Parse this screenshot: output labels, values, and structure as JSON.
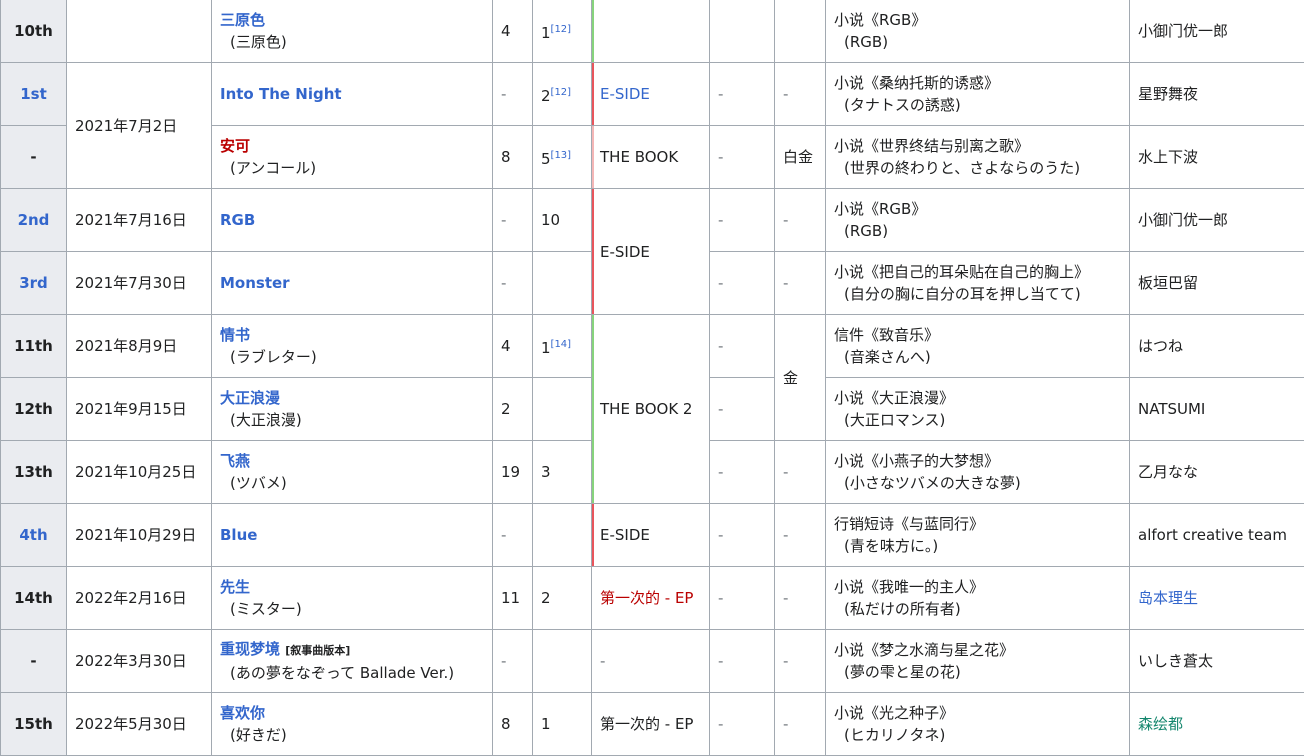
{
  "colors": {
    "header_bg": "#eaecf0",
    "link": "#3366cc",
    "redlink": "#ba0000",
    "green_bar": "#87d37c",
    "red_bar": "#e8555c",
    "pink_bar": "#f4b6b6"
  },
  "rows": [
    {
      "no": "10th",
      "date": "",
      "title": "三原色",
      "subtitle": "(三原色)",
      "c4": "4",
      "c5": "1",
      "c5_ref": "[12]",
      "album": "",
      "c7": "",
      "c8": "",
      "source": "小说《RGB》",
      "source_sub": "(RGB)",
      "author": "小御门优一郎"
    },
    {
      "no": "1st",
      "date": "2021年7月2日",
      "title": "Into The Night",
      "c4": "-",
      "c5": "2",
      "c5_ref": "[12]",
      "album": "E-SIDE",
      "c7": "-",
      "c8": "-",
      "source": "小说《桑纳托斯的诱惑》",
      "source_sub": "(タナトスの誘惑)",
      "author": "星野舞夜"
    },
    {
      "no": "-",
      "title": "安可",
      "subtitle": "(アンコール)",
      "c4": "8",
      "c5": "5",
      "c5_ref": "[13]",
      "album": "THE BOOK",
      "c7": "-",
      "c8": "白金",
      "source": "小说《世界终结与别离之歌》",
      "source_sub": "(世界の終わりと、さよならのうた)",
      "author": "水上下波"
    },
    {
      "no": "2nd",
      "date": "2021年7月16日",
      "title": "RGB",
      "c4": "-",
      "c5": "10",
      "album": "E-SIDE",
      "c7": "-",
      "c8": "-",
      "source": "小说《RGB》",
      "source_sub": "(RGB)",
      "author": "小御门优一郎"
    },
    {
      "no": "3rd",
      "date": "2021年7月30日",
      "title": "Monster",
      "c4": "-",
      "c5": "",
      "c7": "-",
      "c8": "-",
      "source": "小说《把自己的耳朵贴在自己的胸上》",
      "source_sub": "(自分の胸に自分の耳を押し当てて)",
      "author": "板垣巴留"
    },
    {
      "no": "11th",
      "date": "2021年8月9日",
      "title": "情书",
      "subtitle": "(ラブレター)",
      "c4": "4",
      "c5": "1",
      "c5_ref": "[14]",
      "album": "THE BOOK 2",
      "c7": "-",
      "c8": "金",
      "source": "信件《致音乐》",
      "source_sub": "(音楽さんへ)",
      "author": "はつね"
    },
    {
      "no": "12th",
      "date": "2021年9月15日",
      "title": "大正浪漫",
      "subtitle": "(大正浪漫)",
      "c4": "2",
      "c5": "",
      "c7": "-",
      "source": "小说《大正浪漫》",
      "source_sub": "(大正ロマンス)",
      "author": "NATSUMI"
    },
    {
      "no": "13th",
      "date": "2021年10月25日",
      "title": "飞燕",
      "subtitle": "(ツバメ)",
      "c4": "19",
      "c5": "3",
      "c7": "-",
      "c8": "-",
      "source": "小说《小燕子的大梦想》",
      "source_sub": "(小さなツバメの大きな夢)",
      "author": "乙月なな"
    },
    {
      "no": "4th",
      "date": "2021年10月29日",
      "title": "Blue",
      "c4": "-",
      "c5": "",
      "album": "E-SIDE",
      "c7": "-",
      "c8": "-",
      "source": "行销短诗《与蓝同行》",
      "source_sub": "(青を味方に。)",
      "author": "alfort creative team"
    },
    {
      "no": "14th",
      "date": "2022年2月16日",
      "title": "先生",
      "subtitle": "(ミスター)",
      "c4": "11",
      "c5": "2",
      "album": "第一次的 - EP",
      "c7": "-",
      "c8": "-",
      "source": "小说《我唯一的主人》",
      "source_sub": "(私だけの所有者)",
      "author": "岛本理生"
    },
    {
      "no": "-",
      "date": "2022年3月30日",
      "title": "重现梦境",
      "title_tag": "[叙事曲版本]",
      "subtitle": "(あの夢をなぞって Ballade Ver.)",
      "c4": "-",
      "c5": "",
      "album": "-",
      "c7": "-",
      "c8": "-",
      "source": "小说《梦之水滴与星之花》",
      "source_sub": "(夢の雫と星の花)",
      "author": "いしき蒼太"
    },
    {
      "no": "15th",
      "date": "2022年5月30日",
      "title": "喜欢你",
      "subtitle": "(好きだ)",
      "c4": "8",
      "c5": "1",
      "album": "第一次的 - EP",
      "c7": "-",
      "c8": "-",
      "source": "小说《光之种子》",
      "source_sub": "(ヒカリノタネ)",
      "author": "森绘都"
    }
  ]
}
